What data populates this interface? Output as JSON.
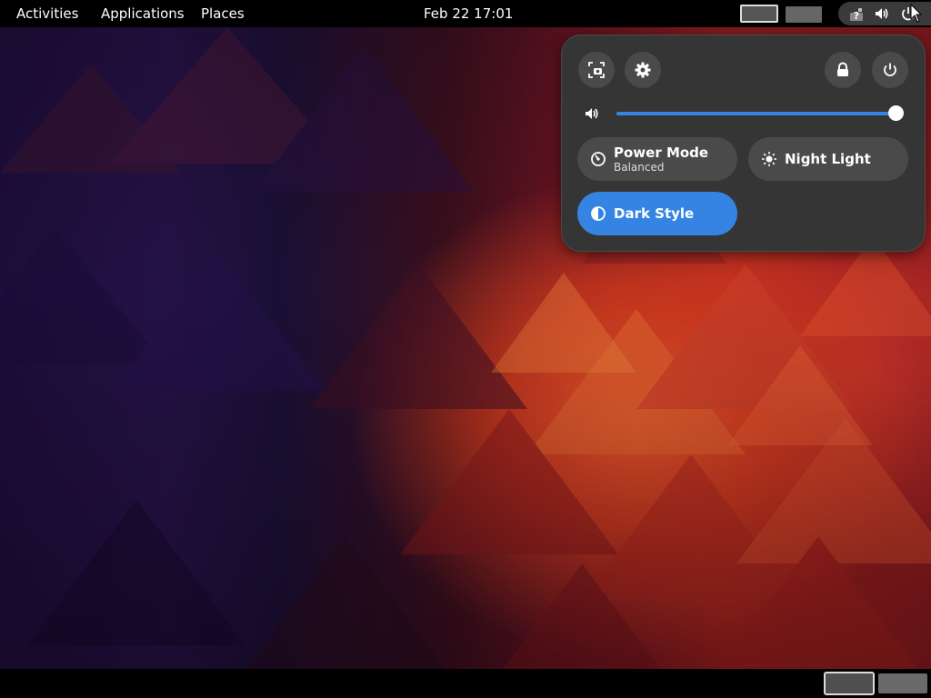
{
  "topbar": {
    "activities": "Activities",
    "applications": "Applications",
    "places": "Places",
    "clock": "Feb 22  17:01",
    "indicators": [
      "network-icon",
      "volume-icon",
      "power-icon"
    ]
  },
  "quick_settings": {
    "top_buttons": [
      "screenshot-icon",
      "settings-icon",
      "lock-icon",
      "power-off-icon"
    ],
    "volume": {
      "level": 1.0
    },
    "toggles": [
      {
        "title": "Power Mode",
        "subtitle": "Balanced",
        "icon": "power-mode-icon",
        "active": false
      },
      {
        "title": "Night Light",
        "subtitle": "",
        "icon": "night-light-icon",
        "active": false
      },
      {
        "title": "Dark Style",
        "subtitle": "",
        "icon": "dark-style-icon",
        "active": true
      }
    ]
  },
  "colors": {
    "accent": "#3584e4",
    "panel_bg": "#353535",
    "button_bg": "#4a4a4a"
  }
}
